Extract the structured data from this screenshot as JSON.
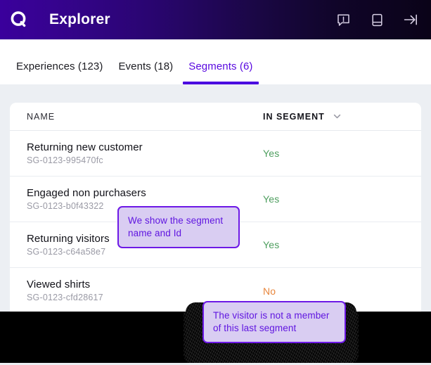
{
  "header": {
    "logo_icon": "q-logo-icon",
    "title": "Explorer",
    "actions": [
      {
        "icon": "comment-alert-icon",
        "label": "Feedback"
      },
      {
        "icon": "book-icon",
        "label": "Documentation"
      },
      {
        "icon": "arrow-to-line-right-icon",
        "label": "Collapse panel"
      }
    ]
  },
  "tabs": [
    {
      "label": "Experiences (123)",
      "active": false
    },
    {
      "label": "Events (18)",
      "active": false
    },
    {
      "label": "Segments (6)",
      "active": true
    }
  ],
  "table": {
    "columns": {
      "name": "NAME",
      "in_segment": "IN SEGMENT",
      "sort_icon": "chevron-down-icon"
    },
    "rows": [
      {
        "name": "Returning new customer",
        "id": "SG-0123-995470fc",
        "in_segment": "Yes",
        "state": "yes"
      },
      {
        "name": "Engaged non purchasers",
        "id": "SG-0123-b0f43322",
        "in_segment": "Yes",
        "state": "yes"
      },
      {
        "name": "Returning visitors",
        "id": "SG-0123-c64a58e7",
        "in_segment": "Yes",
        "state": "yes"
      },
      {
        "name": "Viewed shirts",
        "id": "SG-0123-cfd28617",
        "in_segment": "No",
        "state": "no"
      }
    ]
  },
  "tooltips": {
    "segment_name": "We show the segment name and Id",
    "not_member": "The visitor is not a member of this last segment"
  },
  "colors": {
    "brand_purple": "#4a00e0",
    "tab_active": "#5a0ae0",
    "yes_green": "#4d9e5e",
    "no_orange": "#e8863c",
    "tooltip_fill": "#d9cdf2",
    "tooltip_border": "#6d19e6",
    "page_background": "#eceff3"
  }
}
